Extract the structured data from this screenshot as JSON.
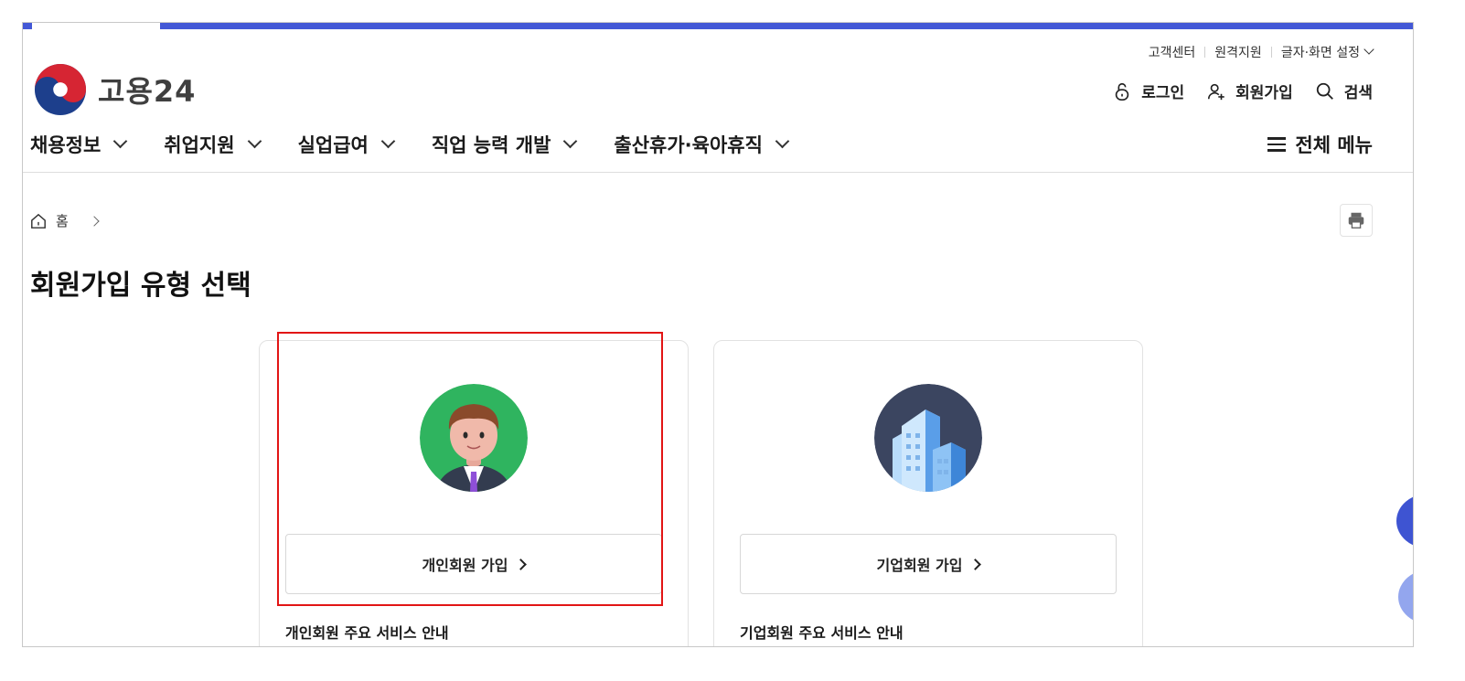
{
  "brand": {
    "name": "고용24"
  },
  "utility": {
    "customer_center": "고객센터",
    "remote_support": "원격지원",
    "display_settings": "글자·화면 설정"
  },
  "actions": {
    "login": "로그인",
    "signup": "회원가입",
    "search": "검색"
  },
  "gnb": {
    "items": [
      "채용정보",
      "취업지원",
      "실업급여",
      "직업 능력 개발",
      "출산휴가·육아휴직"
    ],
    "all_menu": "전체 메뉴"
  },
  "breadcrumb": {
    "home": "홈"
  },
  "page": {
    "title": "회원가입 유형 선택"
  },
  "cards": [
    {
      "button": "개인회원 가입",
      "service": "개인회원 주요 서비스 안내",
      "icon": "person-avatar-icon",
      "bg": "#2fb45f"
    },
    {
      "button": "기업회원 가입",
      "service": "기업회원 주요 서비스 안내",
      "icon": "building-icon",
      "bg": "#3b4560"
    }
  ],
  "colors": {
    "accent": "#4358d6",
    "highlight": "#e21515"
  }
}
